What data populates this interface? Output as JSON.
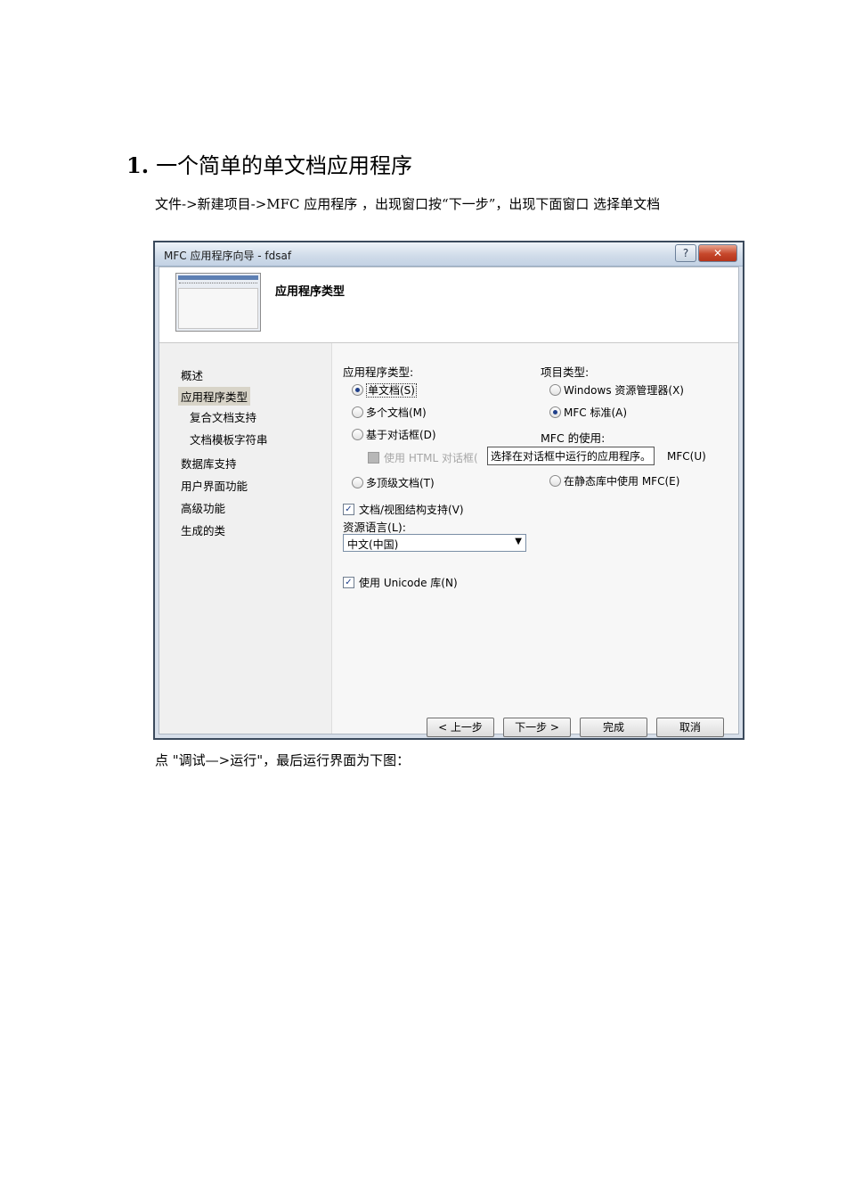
{
  "heading": {
    "number": "1.",
    "text": "一个简单的单文档应用程序"
  },
  "para1": "文件->新建项目->MFC 应用程序 ，出现窗口按“下一步”，出现下面窗口  选择单文档",
  "para2": "点 \"调试—>运行\"，最后运行界面为下图：",
  "dialog": {
    "title": "MFC 应用程序向导 - fdsaf",
    "help_label": "?",
    "close_label": "✕",
    "banner_title": "应用程序类型",
    "nav": [
      "概述",
      "应用程序类型",
      "复合文档支持",
      "文档模板字符串",
      "数据库支持",
      "用户界面功能",
      "高级功能",
      "生成的类"
    ],
    "app_type_label": "应用程序类型:",
    "app_types": [
      "单文档(S)",
      "多个文档(M)",
      "基于对话框(D)",
      "多顶级文档(T)"
    ],
    "html_dialog": "使用 HTML 对话框(",
    "tooltip": "选择在对话框中运行的应用程序。",
    "project_type_label": "项目类型:",
    "project_types": [
      "Windows 资源管理器(X)",
      "MFC 标准(A)"
    ],
    "mfc_use_label": "MFC 的使用:",
    "mfc_use_options": [
      "MFC(U)",
      "在静态库中使用 MFC(E)"
    ],
    "doc_view": "文档/视图结构支持(V)",
    "resource_lang_label": "资源语言(L):",
    "resource_lang_value": "中文(中国)",
    "unicode": "使用 Unicode 库(N)",
    "check_mark": "✓",
    "dropdown_arrow": "▼",
    "buttons": {
      "prev": "< 上一步",
      "next": "下一步 >",
      "finish": "完成",
      "cancel": "取消"
    }
  }
}
